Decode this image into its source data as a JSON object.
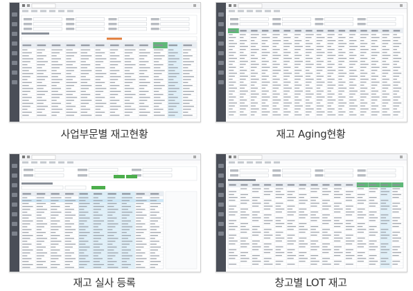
{
  "panels": [
    {
      "caption": "사업부문별 재고현황",
      "variant": "stock"
    },
    {
      "caption": "재고 Aging현황",
      "variant": "aging"
    },
    {
      "caption": "재고 실사 등록",
      "variant": "count"
    },
    {
      "caption": "창고별 LOT 재고",
      "variant": "lot"
    }
  ],
  "colors": {
    "sidebar": "#4a4e57",
    "titlebar": "#ffffff",
    "grid_header": "#e9edf2",
    "grid_line": "#dfe3e8",
    "highlight_col": "#d7ecf7",
    "green_cell": "#5fb878",
    "green_button": "#4cae4c",
    "selected_row": "#cde6f5"
  }
}
